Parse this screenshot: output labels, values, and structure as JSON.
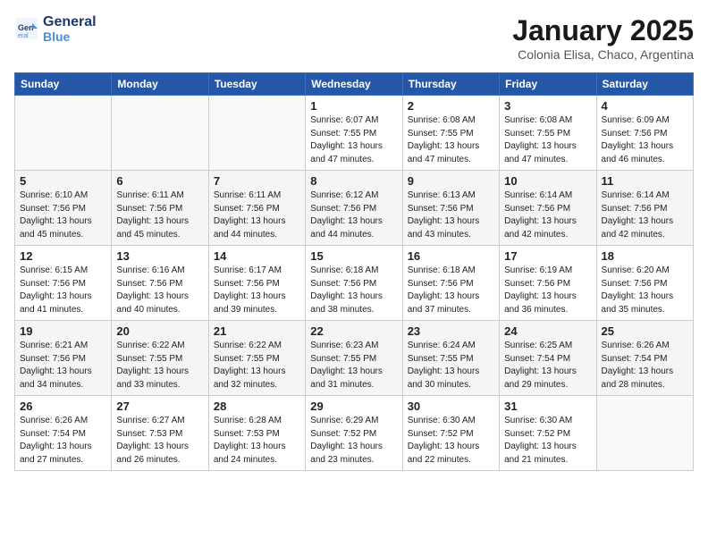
{
  "header": {
    "logo_line1": "General",
    "logo_line2": "Blue",
    "month": "January 2025",
    "location": "Colonia Elisa, Chaco, Argentina"
  },
  "weekdays": [
    "Sunday",
    "Monday",
    "Tuesday",
    "Wednesday",
    "Thursday",
    "Friday",
    "Saturday"
  ],
  "weeks": [
    [
      {
        "day": "",
        "info": ""
      },
      {
        "day": "",
        "info": ""
      },
      {
        "day": "",
        "info": ""
      },
      {
        "day": "1",
        "info": "Sunrise: 6:07 AM\nSunset: 7:55 PM\nDaylight: 13 hours\nand 47 minutes."
      },
      {
        "day": "2",
        "info": "Sunrise: 6:08 AM\nSunset: 7:55 PM\nDaylight: 13 hours\nand 47 minutes."
      },
      {
        "day": "3",
        "info": "Sunrise: 6:08 AM\nSunset: 7:55 PM\nDaylight: 13 hours\nand 47 minutes."
      },
      {
        "day": "4",
        "info": "Sunrise: 6:09 AM\nSunset: 7:56 PM\nDaylight: 13 hours\nand 46 minutes."
      }
    ],
    [
      {
        "day": "5",
        "info": "Sunrise: 6:10 AM\nSunset: 7:56 PM\nDaylight: 13 hours\nand 45 minutes."
      },
      {
        "day": "6",
        "info": "Sunrise: 6:11 AM\nSunset: 7:56 PM\nDaylight: 13 hours\nand 45 minutes."
      },
      {
        "day": "7",
        "info": "Sunrise: 6:11 AM\nSunset: 7:56 PM\nDaylight: 13 hours\nand 44 minutes."
      },
      {
        "day": "8",
        "info": "Sunrise: 6:12 AM\nSunset: 7:56 PM\nDaylight: 13 hours\nand 44 minutes."
      },
      {
        "day": "9",
        "info": "Sunrise: 6:13 AM\nSunset: 7:56 PM\nDaylight: 13 hours\nand 43 minutes."
      },
      {
        "day": "10",
        "info": "Sunrise: 6:14 AM\nSunset: 7:56 PM\nDaylight: 13 hours\nand 42 minutes."
      },
      {
        "day": "11",
        "info": "Sunrise: 6:14 AM\nSunset: 7:56 PM\nDaylight: 13 hours\nand 42 minutes."
      }
    ],
    [
      {
        "day": "12",
        "info": "Sunrise: 6:15 AM\nSunset: 7:56 PM\nDaylight: 13 hours\nand 41 minutes."
      },
      {
        "day": "13",
        "info": "Sunrise: 6:16 AM\nSunset: 7:56 PM\nDaylight: 13 hours\nand 40 minutes."
      },
      {
        "day": "14",
        "info": "Sunrise: 6:17 AM\nSunset: 7:56 PM\nDaylight: 13 hours\nand 39 minutes."
      },
      {
        "day": "15",
        "info": "Sunrise: 6:18 AM\nSunset: 7:56 PM\nDaylight: 13 hours\nand 38 minutes."
      },
      {
        "day": "16",
        "info": "Sunrise: 6:18 AM\nSunset: 7:56 PM\nDaylight: 13 hours\nand 37 minutes."
      },
      {
        "day": "17",
        "info": "Sunrise: 6:19 AM\nSunset: 7:56 PM\nDaylight: 13 hours\nand 36 minutes."
      },
      {
        "day": "18",
        "info": "Sunrise: 6:20 AM\nSunset: 7:56 PM\nDaylight: 13 hours\nand 35 minutes."
      }
    ],
    [
      {
        "day": "19",
        "info": "Sunrise: 6:21 AM\nSunset: 7:56 PM\nDaylight: 13 hours\nand 34 minutes."
      },
      {
        "day": "20",
        "info": "Sunrise: 6:22 AM\nSunset: 7:55 PM\nDaylight: 13 hours\nand 33 minutes."
      },
      {
        "day": "21",
        "info": "Sunrise: 6:22 AM\nSunset: 7:55 PM\nDaylight: 13 hours\nand 32 minutes."
      },
      {
        "day": "22",
        "info": "Sunrise: 6:23 AM\nSunset: 7:55 PM\nDaylight: 13 hours\nand 31 minutes."
      },
      {
        "day": "23",
        "info": "Sunrise: 6:24 AM\nSunset: 7:55 PM\nDaylight: 13 hours\nand 30 minutes."
      },
      {
        "day": "24",
        "info": "Sunrise: 6:25 AM\nSunset: 7:54 PM\nDaylight: 13 hours\nand 29 minutes."
      },
      {
        "day": "25",
        "info": "Sunrise: 6:26 AM\nSunset: 7:54 PM\nDaylight: 13 hours\nand 28 minutes."
      }
    ],
    [
      {
        "day": "26",
        "info": "Sunrise: 6:26 AM\nSunset: 7:54 PM\nDaylight: 13 hours\nand 27 minutes."
      },
      {
        "day": "27",
        "info": "Sunrise: 6:27 AM\nSunset: 7:53 PM\nDaylight: 13 hours\nand 26 minutes."
      },
      {
        "day": "28",
        "info": "Sunrise: 6:28 AM\nSunset: 7:53 PM\nDaylight: 13 hours\nand 24 minutes."
      },
      {
        "day": "29",
        "info": "Sunrise: 6:29 AM\nSunset: 7:52 PM\nDaylight: 13 hours\nand 23 minutes."
      },
      {
        "day": "30",
        "info": "Sunrise: 6:30 AM\nSunset: 7:52 PM\nDaylight: 13 hours\nand 22 minutes."
      },
      {
        "day": "31",
        "info": "Sunrise: 6:30 AM\nSunset: 7:52 PM\nDaylight: 13 hours\nand 21 minutes."
      },
      {
        "day": "",
        "info": ""
      }
    ]
  ]
}
